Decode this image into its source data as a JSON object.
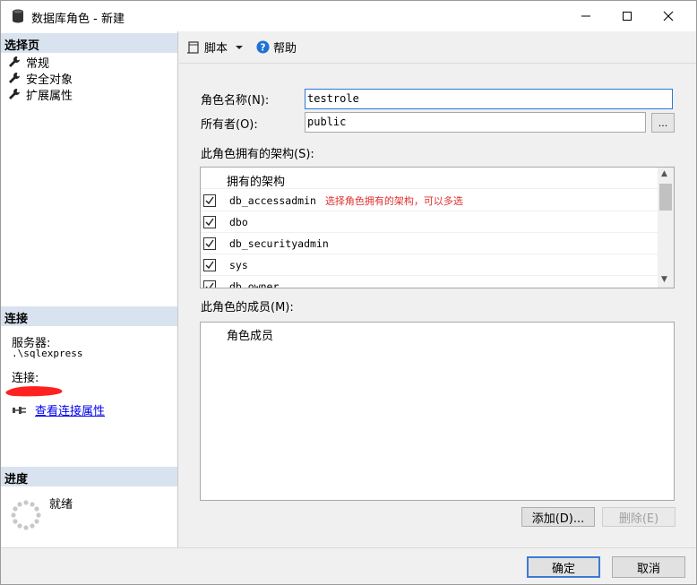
{
  "window": {
    "title": "数据库角色 - 新建"
  },
  "left": {
    "select_page_header": "选择页",
    "pages": [
      {
        "label": "常规"
      },
      {
        "label": "安全对象"
      },
      {
        "label": "扩展属性"
      }
    ],
    "connection_header": "连接",
    "server_label": "服务器:",
    "server_value": ".\\sqlexpress",
    "connection_label": "连接:",
    "view_connection_link": "查看连接属性",
    "progress_header": "进度",
    "progress_status": "就绪"
  },
  "toolbar": {
    "script_label": "脚本",
    "help_label": "帮助"
  },
  "form": {
    "role_name_label": "角色名称(N):",
    "role_name_value": "testrole",
    "owner_label": "所有者(O):",
    "owner_value": "public",
    "browse_label": "...",
    "schemas_label": "此角色拥有的架构(S):",
    "schemas_column": "拥有的架构",
    "schemas": [
      {
        "name": "db_accessadmin",
        "checked": true,
        "note": "选择角色拥有的架构，可以多选"
      },
      {
        "name": "dbo",
        "checked": true,
        "note": ""
      },
      {
        "name": "db_securityadmin",
        "checked": true,
        "note": ""
      },
      {
        "name": "sys",
        "checked": true,
        "note": ""
      },
      {
        "name": "db_owner",
        "checked": true,
        "note": ""
      }
    ],
    "members_label": "此角色的成员(M):",
    "members_column": "角色成员",
    "add_button": "添加(D)...",
    "remove_button": "删除(E)"
  },
  "footer": {
    "ok_button": "确定",
    "cancel_button": "取消"
  },
  "colors": {
    "accent": "#2b79d7",
    "section_header": "#d9e3ef",
    "note_text": "#e03030",
    "redaction": "#ff2020"
  }
}
